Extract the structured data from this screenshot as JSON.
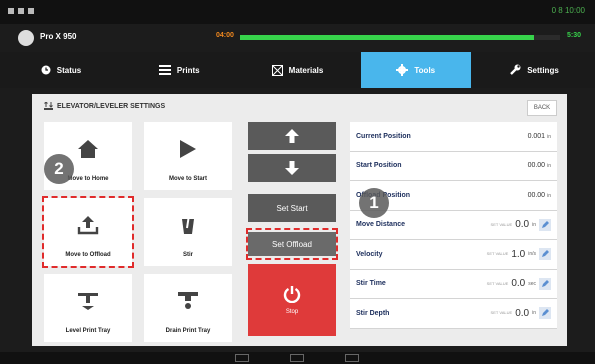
{
  "header": {
    "device_name": "Pro X 950",
    "elapsed": "04:00",
    "remaining": "5:30",
    "progress": 0.92,
    "status_icons": "0 8 10:00"
  },
  "tabs": [
    {
      "label": "Status",
      "icon": "clock-icon",
      "active": false
    },
    {
      "label": "Prints",
      "icon": "list-icon",
      "active": false
    },
    {
      "label": "Materials",
      "icon": "materials-icon",
      "active": false
    },
    {
      "label": "Tools",
      "icon": "gear-icon",
      "active": true
    },
    {
      "label": "Settings",
      "icon": "wrench-icon",
      "active": false
    }
  ],
  "panel": {
    "title": "ELEVATOR/LEVELER SETTINGS",
    "back_label": "BACK"
  },
  "tiles": {
    "move_to_home": "Move to Home",
    "move_to_start": "Move to Start",
    "move_to_offload": "Move to Offload",
    "stir": "Stir",
    "level_print_tray": "Level Print Tray",
    "drain_print_tray": "Drain Print Tray"
  },
  "controls": {
    "set_start": "Set Start",
    "set_offload": "Set Offload",
    "stop": "Stop"
  },
  "properties": {
    "current_position": {
      "label": "Current Position",
      "value": "0.001",
      "unit": "in"
    },
    "start_position": {
      "label": "Start Position",
      "value": "00.00",
      "unit": "in"
    },
    "offload_position": {
      "label": "Offload Position",
      "value": "00.00",
      "unit": "in"
    },
    "move_distance": {
      "label": "Move Distance",
      "set": "SET VALUE",
      "value": "0.0",
      "unit": "in"
    },
    "velocity": {
      "label": "Velocity",
      "set": "SET VALUE",
      "value": "1.0",
      "unit": "in/s"
    },
    "stir_time": {
      "label": "Stir Time",
      "set": "SET VALUE",
      "value": "0.0",
      "unit": "sec"
    },
    "stir_depth": {
      "label": "Stir Depth",
      "set": "SET VALUE",
      "value": "0.0",
      "unit": "in"
    }
  },
  "callouts": {
    "one": "1",
    "two": "2"
  },
  "colors": {
    "tab_active": "#49b6ec",
    "stop_red": "#df3a3a",
    "progress_green": "#37d34b",
    "elapsed_orange": "#f2891f",
    "highlight_dash": "#e02b2b"
  }
}
